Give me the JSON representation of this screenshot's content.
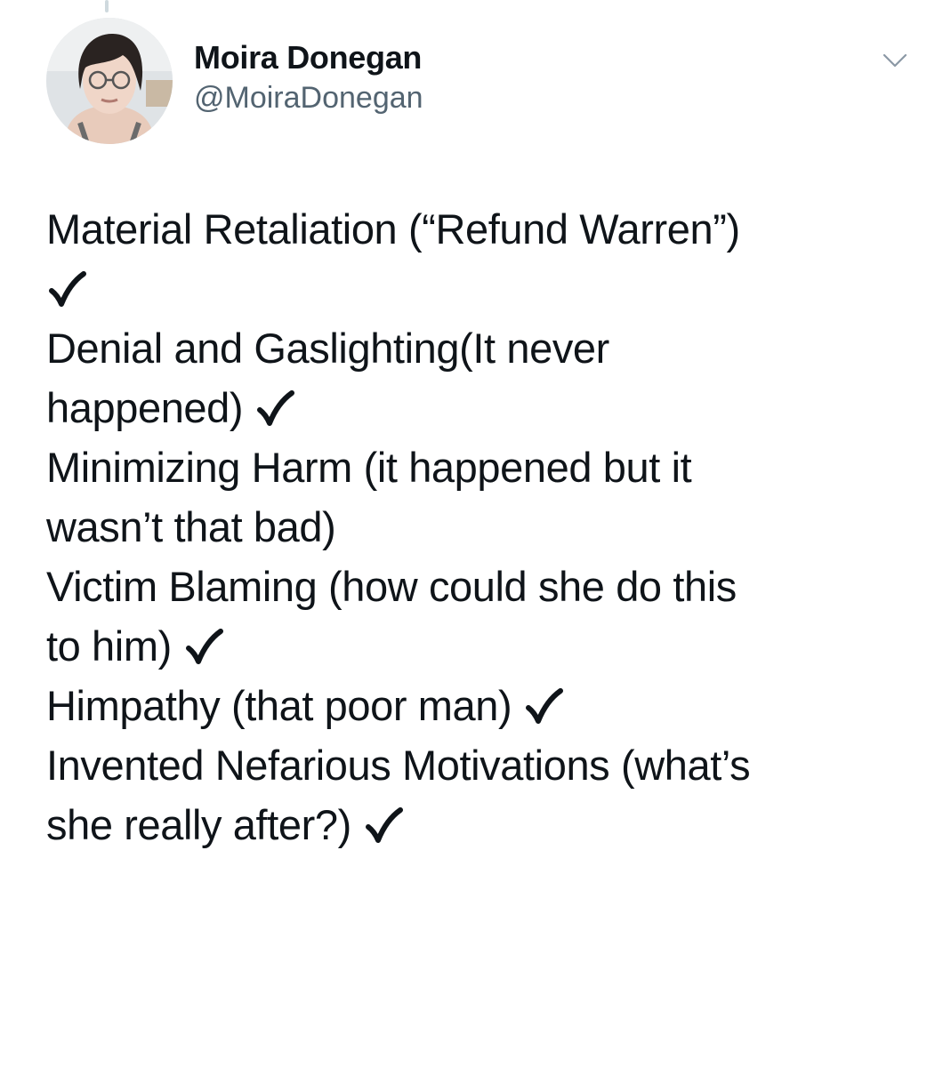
{
  "tweet": {
    "author": {
      "display_name": "Moira Donegan",
      "handle": "@MoiraDonegan"
    },
    "icons": {
      "menu": "chevron-down-icon",
      "check": "check-mark-icon"
    },
    "colors": {
      "text": "#0f1419",
      "secondary": "#536471"
    },
    "lines": [
      "Material Retaliation (“Refund Warren”)",
      "",
      "Denial and Gaslighting(It never",
      "happened) ",
      "Minimizing Harm (it happened but it",
      "wasn’t that bad)",
      "Victim Blaming (how could she do this",
      "to him) ",
      "Himpathy (that poor man) ",
      "Invented Nefarious Motivations (what’s",
      "she really after?) "
    ]
  }
}
